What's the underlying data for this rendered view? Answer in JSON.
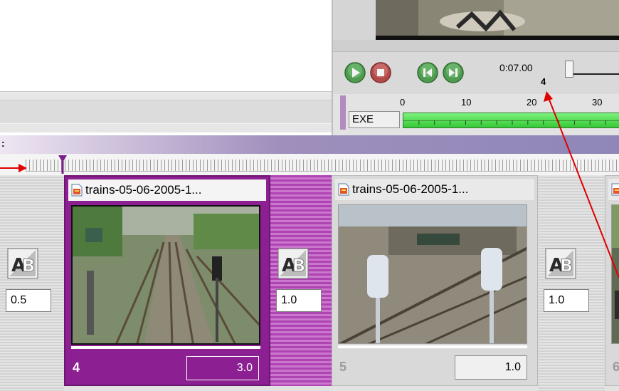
{
  "preview": {
    "time": "0:07.00",
    "frame": "4",
    "buttons": [
      {
        "name": "play-button",
        "icon": "play-icon",
        "color": "#4d9a4d"
      },
      {
        "name": "stop-button",
        "icon": "stop-icon",
        "color": "#b04848"
      },
      {
        "name": "prev-button",
        "icon": "skip-back-icon",
        "color": "#4d9a4d"
      },
      {
        "name": "next-button",
        "icon": "skip-forward-icon",
        "color": "#4d9a4d"
      }
    ]
  },
  "track": {
    "label": "EXE",
    "ruler_numbers": [
      "0",
      "10",
      "20",
      "30"
    ],
    "bar_color": "#52d852"
  },
  "timeline": {
    "header_caption": ":",
    "header_color": "#9a8fc0"
  },
  "transitions": [
    {
      "icon": "ab-transition-icon",
      "duration": "0.5"
    },
    {
      "icon": "ab-transition-icon",
      "duration": "1.0"
    },
    {
      "icon": "ab-transition-icon",
      "duration": "1.0"
    }
  ],
  "clips": [
    {
      "title": "trains-05-06-2005-1...",
      "number": "4",
      "duration": "3.0",
      "selected": true,
      "icon": "video-file-icon"
    },
    {
      "title": "trains-05-06-2005-1...",
      "number": "5",
      "duration": "1.0",
      "selected": false,
      "icon": "video-file-icon"
    },
    {
      "title": "",
      "number": "6",
      "duration": "",
      "selected": false,
      "icon": "video-file-icon"
    }
  ],
  "colors": {
    "selected_clip": "#8c1f91",
    "annotation_arrow": "#e00000"
  }
}
